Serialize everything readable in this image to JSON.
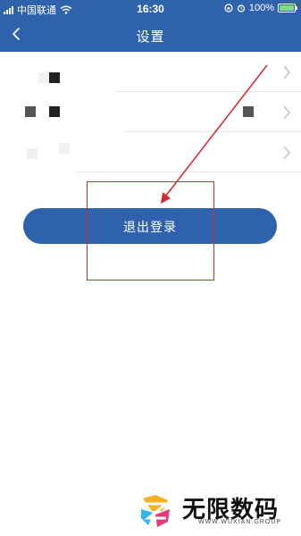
{
  "status_bar": {
    "carrier": "中国联通",
    "time": "16:30",
    "battery_text": "100%",
    "battery_level": 1.0
  },
  "nav": {
    "title": "设置",
    "back_icon": "chevron-left-icon"
  },
  "settings_rows": [
    {
      "chevron_icon": "chevron-right-icon"
    },
    {
      "chevron_icon": "chevron-right-icon"
    },
    {
      "chevron_icon": "chevron-right-icon"
    }
  ],
  "logout_button": {
    "label": "退出登录"
  },
  "watermark": {
    "name": "无限数码",
    "sub": "WWW.WUXIAN.GROUP"
  },
  "colors": {
    "brand_blue": "#2f62ad",
    "annotation_red": "#d9262c"
  }
}
